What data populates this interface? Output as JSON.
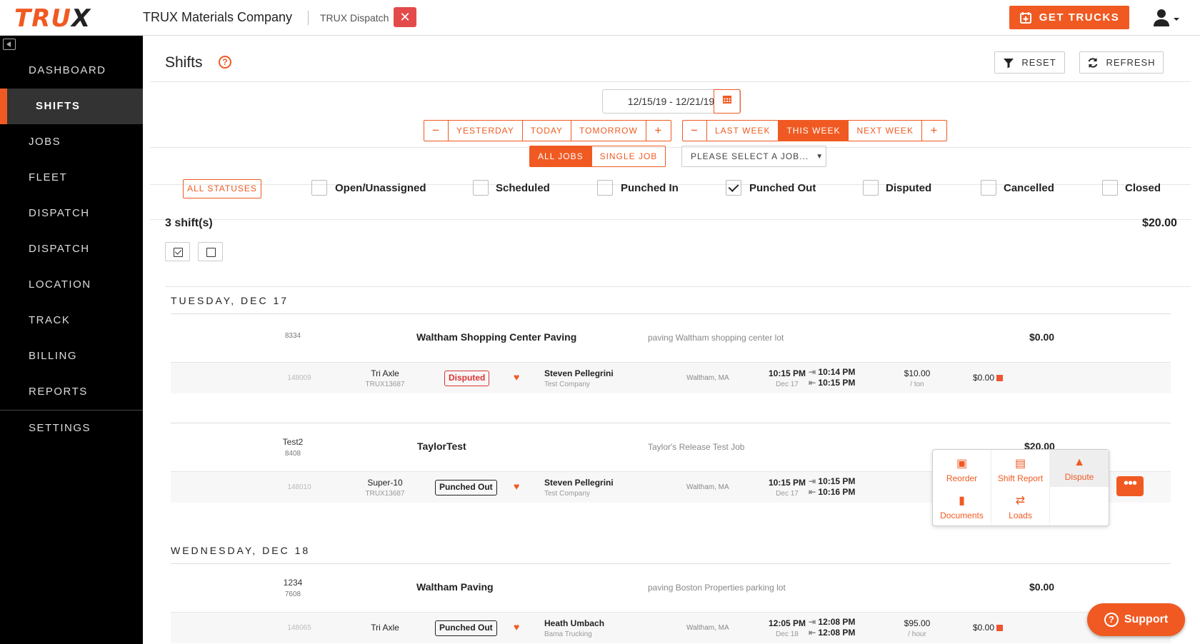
{
  "header": {
    "logo_main": "TRU",
    "logo_x": "X",
    "company": "TRUX Materials Company",
    "dispatch_tab": "TRUX Dispatch",
    "close_glyph": "✕",
    "get_trucks": "GET TRUCKS"
  },
  "sidebar": {
    "items": [
      {
        "label": "DASHBOARD"
      },
      {
        "label": "SHIFTS"
      },
      {
        "label": "JOBS"
      },
      {
        "label": "FLEET"
      },
      {
        "label": "DISPATCH"
      },
      {
        "label": "DISPATCH"
      },
      {
        "label": "LOCATION"
      },
      {
        "label": "TRACK"
      },
      {
        "label": "BILLING"
      },
      {
        "label": "REPORTS"
      },
      {
        "label": "SETTINGS"
      }
    ]
  },
  "page": {
    "title": "Shifts",
    "help": "?",
    "reset": "RESET",
    "refresh": "REFRESH"
  },
  "dates": {
    "range": "12/15/19  -  12/21/19",
    "day_seg": [
      "−",
      "YESTERDAY",
      "TODAY",
      "TOMORROW",
      "+"
    ],
    "week_seg": [
      "−",
      "LAST WEEK",
      "THIS WEEK",
      "NEXT WEEK",
      "+"
    ]
  },
  "jobs": {
    "all": "ALL JOBS",
    "single": "SINGLE JOB",
    "select": "PLEASE SELECT A JOB..."
  },
  "statuses": {
    "all": "ALL STATUSES",
    "items": [
      {
        "label": "Open/Unassigned",
        "checked": false
      },
      {
        "label": "Scheduled",
        "checked": false
      },
      {
        "label": "Punched In",
        "checked": false
      },
      {
        "label": "Punched Out",
        "checked": true
      },
      {
        "label": "Disputed",
        "checked": false
      },
      {
        "label": "Cancelled",
        "checked": false
      },
      {
        "label": "Closed",
        "checked": false
      }
    ]
  },
  "summary": {
    "count": "3 shift(s)",
    "total": "$20.00"
  },
  "days": [
    {
      "label": "TUESDAY, DEC 17",
      "jobs": [
        {
          "id": "8334",
          "sub": "",
          "name": "Waltham Shopping Center Paving",
          "desc": "paving Waltham shopping center lot",
          "amount": "$0.00",
          "shift": {
            "id": "148009",
            "truck": "Tri Axle",
            "truck_no": "TRUX13687",
            "status": "Disputed",
            "driver": "Steven Pellegrini",
            "company": "Test Company",
            "location": "Waltham, MA",
            "time": "10:15 PM",
            "date": "Dec 17",
            "in": "10:14 PM",
            "out": "10:15 PM",
            "rate": "$10.00",
            "unit": "/ ton",
            "amount": "$0.00"
          }
        },
        {
          "id": "Test2",
          "sub": "8408",
          "name": "TaylorTest",
          "desc": "Taylor's Release Test Job",
          "amount": "$20.00",
          "shift": {
            "id": "148010",
            "truck": "Super-10",
            "truck_no": "TRUX13687",
            "status": "Punched Out",
            "driver": "Steven Pellegrini",
            "company": "Test Company",
            "location": "Waltham, MA",
            "time": "10:15 PM",
            "date": "Dec 17",
            "in": "10:15 PM",
            "out": "10:16 PM",
            "rate": "",
            "unit": "",
            "amount": ""
          }
        }
      ]
    },
    {
      "label": "WEDNESDAY, DEC 18",
      "jobs": [
        {
          "id": "1234",
          "sub": "7608",
          "name": "Waltham Paving",
          "desc": "paving Boston Properties parking lot",
          "amount": "$0.00",
          "shift": {
            "id": "148065",
            "truck": "Tri Axle",
            "truck_no": "",
            "status": "Punched Out",
            "driver": "Heath Umbach",
            "company": "Bama Trucking",
            "location": "Waltham, MA",
            "time": "12:05 PM",
            "date": "Dec 18",
            "in": "12:08 PM",
            "out": "12:08 PM",
            "rate": "$95.00",
            "unit": "/ hour",
            "amount": "$0.00"
          }
        }
      ]
    }
  ],
  "popup": {
    "reorder": "Reorder",
    "shift_report": "Shift Report",
    "dispute": "Dispute",
    "documents": "Documents",
    "loads": "Loads"
  },
  "support": "Support",
  "colors": {
    "accent": "#f05a22",
    "disputed": "#dd3333",
    "sidebar": "#000000"
  }
}
